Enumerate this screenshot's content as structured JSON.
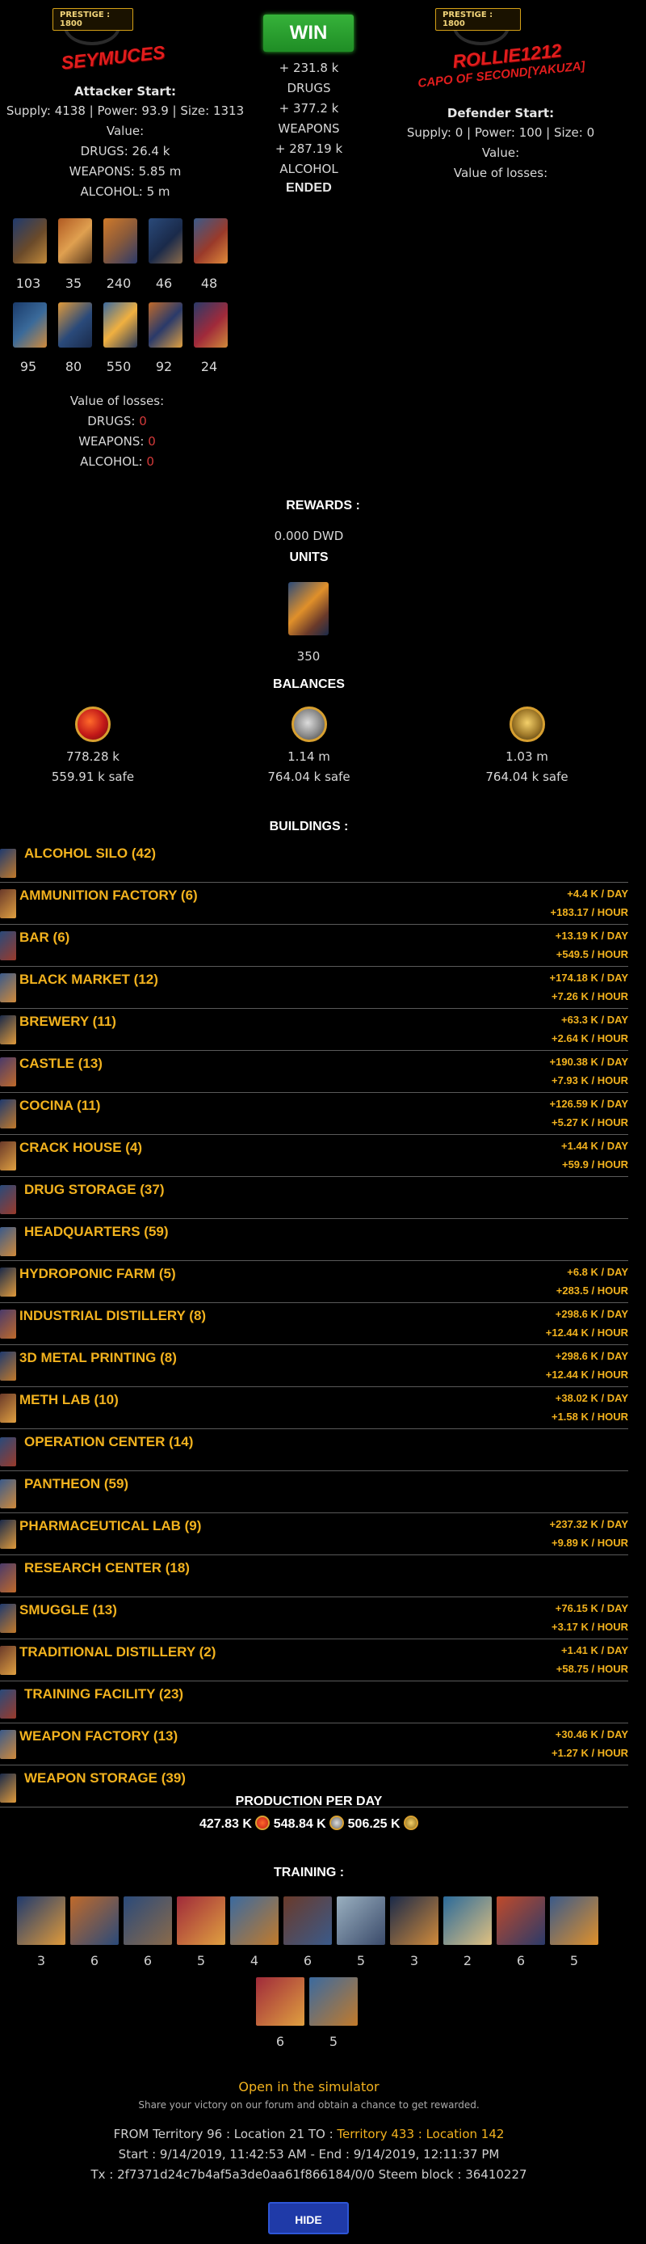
{
  "attacker": {
    "prestige": "PRESTIGE : 1800",
    "name": "SEYMUCES",
    "start_label": "Attacker Start:",
    "stats": "Supply: 4138 | Power: 93.9 | Size: 1313",
    "value_label": "Value:",
    "value_lines": [
      "DRUGS: 26.4 k",
      "WEAPONS: 5.85 m",
      "ALCOHOL: 5 m"
    ],
    "units_row1": [
      "103",
      "35",
      "240",
      "46",
      "48"
    ],
    "units_row2": [
      "95",
      "80",
      "550",
      "92",
      "24"
    ],
    "losses_label": "Value of losses:",
    "losses": [
      {
        "label": "DRUGS:",
        "value": "0"
      },
      {
        "label": "WEAPONS:",
        "value": "0"
      },
      {
        "label": "ALCOHOL:",
        "value": "0"
      }
    ]
  },
  "result": {
    "button": "WIN",
    "lines": [
      {
        "text": "+ 231.8 k",
        "kind": "green"
      },
      {
        "text": "DRUGS",
        "kind": "green"
      },
      {
        "text": "+ 377.2 k",
        "kind": "green"
      },
      {
        "text": "WEAPONS",
        "kind": "green"
      },
      {
        "text": "+ 287.19 k",
        "kind": "green"
      },
      {
        "text": "ALCOHOL",
        "kind": "green"
      }
    ],
    "status": "ENDED"
  },
  "defender": {
    "prestige": "PRESTIGE : 1800",
    "name": "ROLLIE1212",
    "subtitle": "CAPO OF SECOND[YAKUZA]",
    "start_label": "Defender Start:",
    "stats": "Supply: 0 | Power: 100 | Size: 0",
    "value_label": "Value:",
    "losses_label": "Value of losses:"
  },
  "rewards": {
    "title": "REWARDS :",
    "dwd": "0.000 DWD",
    "units_title": "UNITS",
    "unit_count": "350",
    "balances_title": "BALANCES",
    "balances": [
      {
        "icon": "drugs-icon",
        "amount": "778.28 k",
        "safe": "559.91 k safe"
      },
      {
        "icon": "weapons-icon",
        "amount": "1.14 m",
        "safe": "764.04 k safe"
      },
      {
        "icon": "alcohol-icon",
        "amount": "1.03 m",
        "safe": "764.04 k safe"
      }
    ]
  },
  "buildings": {
    "title": "BUILDINGS :",
    "items": [
      {
        "name": "ALCOHOL SILO (42)",
        "day": "",
        "hour": ""
      },
      {
        "name": "AMMUNITION FACTORY (6)",
        "day": "+4.4 K / DAY",
        "hour": "+183.17 / HOUR"
      },
      {
        "name": "BAR (6)",
        "day": "+13.19 K / DAY",
        "hour": "+549.5 / HOUR"
      },
      {
        "name": "BLACK MARKET (12)",
        "day": "+174.18 K / DAY",
        "hour": "+7.26 K / HOUR"
      },
      {
        "name": "BREWERY (11)",
        "day": "+63.3 K / DAY",
        "hour": "+2.64 K / HOUR"
      },
      {
        "name": "CASTLE (13)",
        "day": "+190.38 K / DAY",
        "hour": "+7.93 K / HOUR"
      },
      {
        "name": "COCINA (11)",
        "day": "+126.59 K / DAY",
        "hour": "+5.27 K / HOUR"
      },
      {
        "name": "CRACK HOUSE (4)",
        "day": "+1.44 K / DAY",
        "hour": "+59.9 / HOUR"
      },
      {
        "name": "DRUG STORAGE (37)",
        "day": "",
        "hour": ""
      },
      {
        "name": "HEADQUARTERS (59)",
        "day": "",
        "hour": ""
      },
      {
        "name": "HYDROPONIC FARM (5)",
        "day": "+6.8 K / DAY",
        "hour": "+283.5 / HOUR"
      },
      {
        "name": "INDUSTRIAL DISTILLERY (8)",
        "day": "+298.6 K / DAY",
        "hour": "+12.44 K / HOUR"
      },
      {
        "name": "3D METAL PRINTING (8)",
        "day": "+298.6 K / DAY",
        "hour": "+12.44 K / HOUR"
      },
      {
        "name": "METH LAB (10)",
        "day": "+38.02 K / DAY",
        "hour": "+1.58 K / HOUR"
      },
      {
        "name": "OPERATION CENTER (14)",
        "day": "",
        "hour": ""
      },
      {
        "name": "PANTHEON (59)",
        "day": "",
        "hour": ""
      },
      {
        "name": "PHARMACEUTICAL LAB (9)",
        "day": "+237.32 K / DAY",
        "hour": "+9.89 K / HOUR"
      },
      {
        "name": "RESEARCH CENTER (18)",
        "day": "",
        "hour": ""
      },
      {
        "name": "SMUGGLE (13)",
        "day": "+76.15 K / DAY",
        "hour": "+3.17 K / HOUR"
      },
      {
        "name": "TRADITIONAL DISTILLERY (2)",
        "day": "+1.41 K / DAY",
        "hour": "+58.75 / HOUR"
      },
      {
        "name": "TRAINING FACILITY (23)",
        "day": "",
        "hour": ""
      },
      {
        "name": "WEAPON FACTORY (13)",
        "day": "+30.46 K / DAY",
        "hour": "+1.27 K / HOUR"
      },
      {
        "name": "WEAPON STORAGE (39)",
        "day": "",
        "hour": ""
      }
    ]
  },
  "production": {
    "title": "PRODUCTION PER DAY",
    "drugs": "427.83 K",
    "weapons": "548.84 K",
    "alcohol": "506.25 K"
  },
  "training": {
    "title": "TRAINING :",
    "row1": [
      "3",
      "6",
      "6",
      "5",
      "4",
      "6",
      "5",
      "3",
      "2",
      "6",
      "5"
    ],
    "row2": [
      "6",
      "5"
    ]
  },
  "footer": {
    "simulator_link": "Open in the simulator",
    "share_text": "Share your victory on our forum and obtain a chance to get rewarded.",
    "route_from": "FROM Territory 96 : Location 21 TO : ",
    "route_to": "Territory 433 : Location 142",
    "times": "Start : 9/14/2019, 11:42:53 AM - End : 9/14/2019, 12:11:37 PM",
    "tx": "Tx : 2f7371d24c7b4af5a3de0aa61f866184/0/0 Steem block : 36410227",
    "hide_button": "HIDE DETAILS"
  }
}
